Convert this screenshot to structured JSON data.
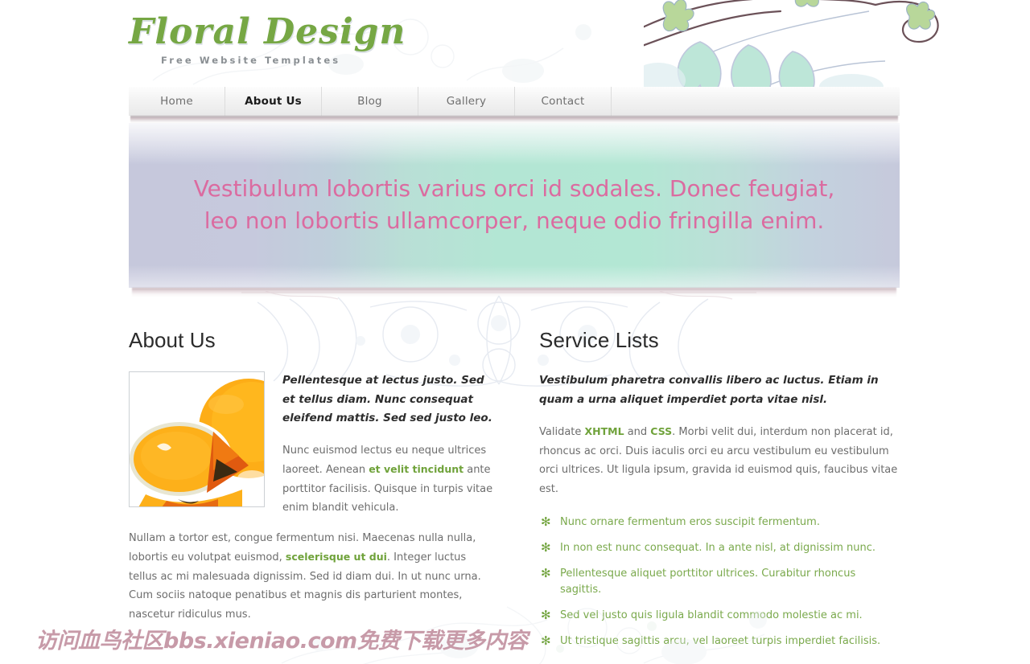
{
  "site": {
    "logo_name": "Floral Design",
    "logo_tagline": "Free Website Templates",
    "brand_green": "#76a744",
    "accent_pink": "#db6ba0",
    "link_green": "#6fa23a"
  },
  "nav": {
    "items": [
      {
        "label": "Home",
        "active": false
      },
      {
        "label": "About Us",
        "active": true
      },
      {
        "label": "Blog",
        "active": false
      },
      {
        "label": "Gallery",
        "active": false
      },
      {
        "label": "Contact",
        "active": false
      }
    ]
  },
  "banner": {
    "text": "Vestibulum lobortis varius orci id sodales. Donec feugiat, leo non lobortis ullamcorper, neque odio fringilla enim."
  },
  "about": {
    "title": "About Us",
    "image_alt": "orange slices photo",
    "lead": "Pellentesque at lectus justo. Sed et tellus diam. Nunc consequat eleifend mattis. Sed sed justo leo.",
    "para1_pre": "Nunc euismod lectus eu neque ultrices laoreet. Aenean ",
    "para1_link": "et velit tincidunt",
    "para1_post": " ante porttitor facilisis. Quisque in turpis vitae enim blandit vehicula.",
    "para2_pre": "Nullam a tortor est, congue fermentum nisi. Maecenas nulla nulla, lobortis eu volutpat euismod, ",
    "para2_link": "scelerisque ut dui",
    "para2_post": ". Integer luctus tellus ac mi malesuada dignissim. Sed id diam dui. In ut nunc urna. Cum sociis natoque penatibus et magnis dis parturient montes, nascetur ridiculus mus."
  },
  "services": {
    "title": "Service Lists",
    "lead": "Vestibulum pharetra convallis libero ac luctus. Etiam in quam a urna aliquet imperdiet porta vitae nisl.",
    "para_pre": "Validate ",
    "para_link1": "XHTML",
    "para_mid": " and ",
    "para_link2": "CSS",
    "para_post": ". Morbi velit dui, interdum non placerat id, rhoncus ac orci. Duis iaculis orci eu arcu vestibulum eu vestibulum orci ultrices. Ut ligula ipsum, gravida id euismod quis, faucibus vitae est.",
    "bullet_glyph": "✻",
    "items": [
      "Nunc ornare fermentum eros suscipit fermentum.",
      "In non est nunc consequat. In a ante nisl, at dignissim nunc.",
      "Pellentesque aliquet porttitor ultrices. Curabitur rhoncus sagittis.",
      "Sed vel justo quis ligula blandit commodo molestie ac mi.",
      "Ut tristique sagittis arcu, vel laoreet turpis imperdiet facilisis."
    ]
  },
  "footer": {
    "watermark": "访问血鸟社区bbs.xieniao.com免费下载更多内容"
  }
}
